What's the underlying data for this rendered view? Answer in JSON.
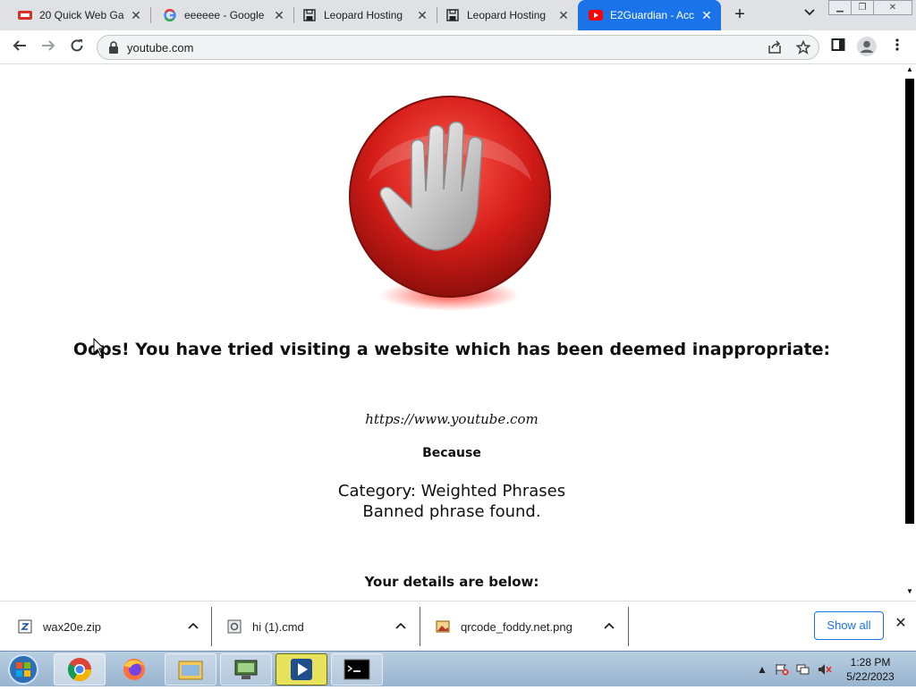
{
  "browser": {
    "tabs": [
      {
        "title": "20 Quick Web Ga",
        "icon": "red-game-favicon-icon",
        "active": false
      },
      {
        "title": "eeeeee - Google",
        "icon": "google-favicon-icon",
        "active": false
      },
      {
        "title": "Leopard Hosting",
        "icon": "floppy-favicon-icon",
        "active": false
      },
      {
        "title": "Leopard Hosting",
        "icon": "floppy-favicon-icon",
        "active": false
      },
      {
        "title": "E2Guardian - Acc",
        "icon": "youtube-favicon-icon",
        "active": true
      }
    ],
    "new_tab_symbol": "+",
    "address": "youtube.com",
    "accent_color": "#1a73e8"
  },
  "page": {
    "headline": "Oops! You have tried visiting a website which has been deemed inappropriate:",
    "blocked_url": "https://www.youtube.com",
    "because_label": "Because",
    "category_line": "Category: Weighted Phrases",
    "reason_line": "Banned phrase found.",
    "details_heading": "Your details are below:"
  },
  "downloads": {
    "items": [
      {
        "name": "wax20e.zip",
        "icon": "zip-file-icon"
      },
      {
        "name": "hi (1).cmd",
        "icon": "cmd-file-icon"
      },
      {
        "name": "qrcode_foddy.net.png",
        "icon": "image-file-icon"
      }
    ],
    "show_all_label": "Show all"
  },
  "taskbar": {
    "apps": [
      "chrome-icon",
      "firefox-icon",
      "explorer-icon",
      "network-app-icon",
      "media-player-icon",
      "cmd-terminal-icon"
    ],
    "clock_time": "1:28 PM",
    "clock_date": "5/22/2023"
  }
}
